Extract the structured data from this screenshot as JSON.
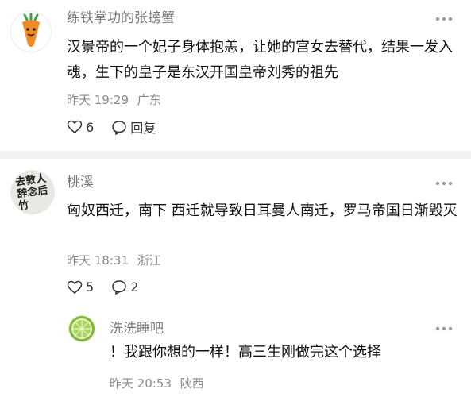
{
  "comments": [
    {
      "username": "练铁掌功的张螃蟹",
      "text": "汉景帝的一个妃子身体抱恙，让她的宫女去替代，结果一发入魂，生下的皇子是东汉开国皇帝刘秀的祖先",
      "time": "昨天 19:29",
      "location": "广东",
      "likes": "6",
      "reply_label": "回复"
    },
    {
      "username": "桃溪",
      "text": "匈奴西迁，南下 西迁就导致日耳曼人南迁，罗马帝国日渐毁灭",
      "time": "昨天 18:31",
      "location": "浙江",
      "likes": "5",
      "replies": "2"
    }
  ],
  "reply": {
    "username": "洗洗睡吧",
    "text": "！我跟你想的一样！高三生刚做完这个选择",
    "time": "昨天 20:53",
    "location": "陕西"
  },
  "avatar2_text": "去敦人辞念后竹",
  "colors": {
    "brand_orange": "#f08a24",
    "leaf_green": "#3aa14a",
    "lime": "#a6d35c"
  }
}
